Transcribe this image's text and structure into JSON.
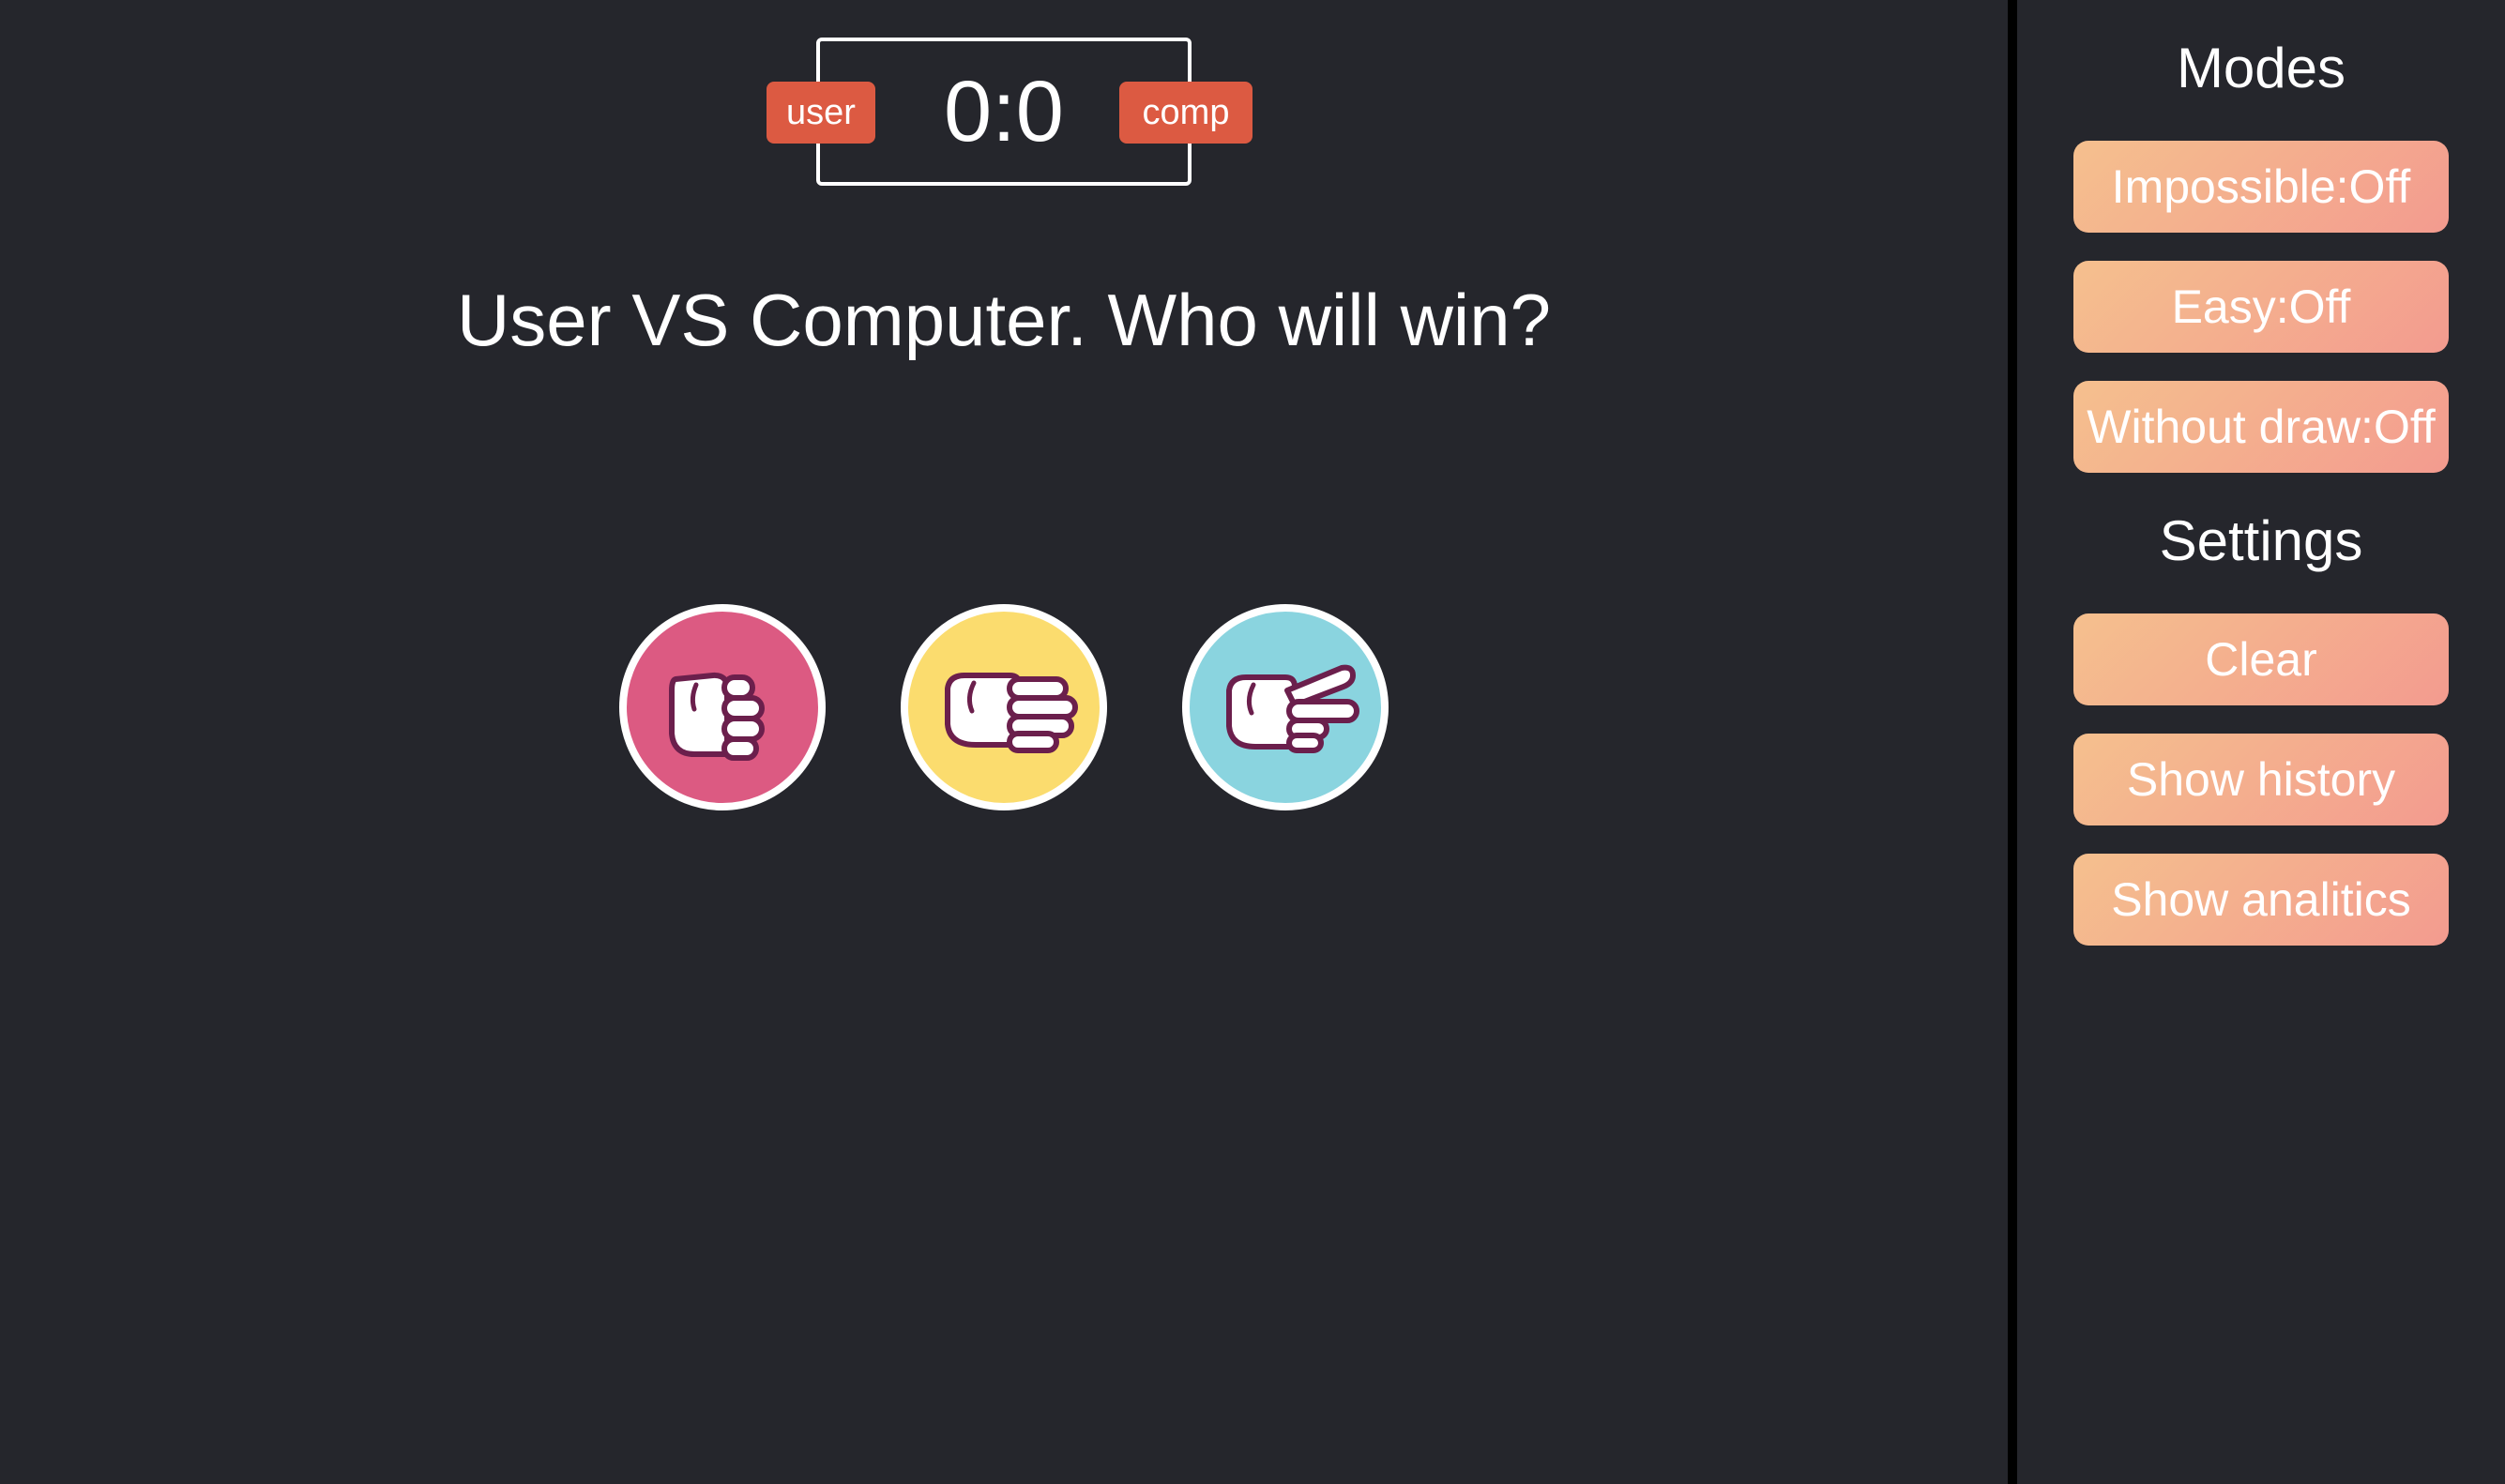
{
  "scoreboard": {
    "score": "0:0",
    "user_label": "user",
    "comp_label": "comp"
  },
  "message": "User VS Computer. Who will win?",
  "choices": [
    {
      "name": "rock",
      "icon": "fist-hand-icon",
      "color": "#dc5a82"
    },
    {
      "name": "paper",
      "icon": "flat-hand-icon",
      "color": "#fbdc6e"
    },
    {
      "name": "scissors",
      "icon": "scissors-hand-icon",
      "color": "#8ad4df"
    }
  ],
  "sidebar": {
    "modes_title": "Modes",
    "modes": [
      {
        "label": "Impossible:Off"
      },
      {
        "label": "Easy:Off"
      },
      {
        "label": "Without draw:Off"
      }
    ],
    "settings_title": "Settings",
    "settings": [
      {
        "label": "Clear"
      },
      {
        "label": "Show history"
      },
      {
        "label": "Show analitics"
      }
    ]
  },
  "colors": {
    "background": "#25262c",
    "badge": "#dc5a42",
    "button_gradient_start": "#f5c08e",
    "button_gradient_end": "#f39b8f"
  }
}
